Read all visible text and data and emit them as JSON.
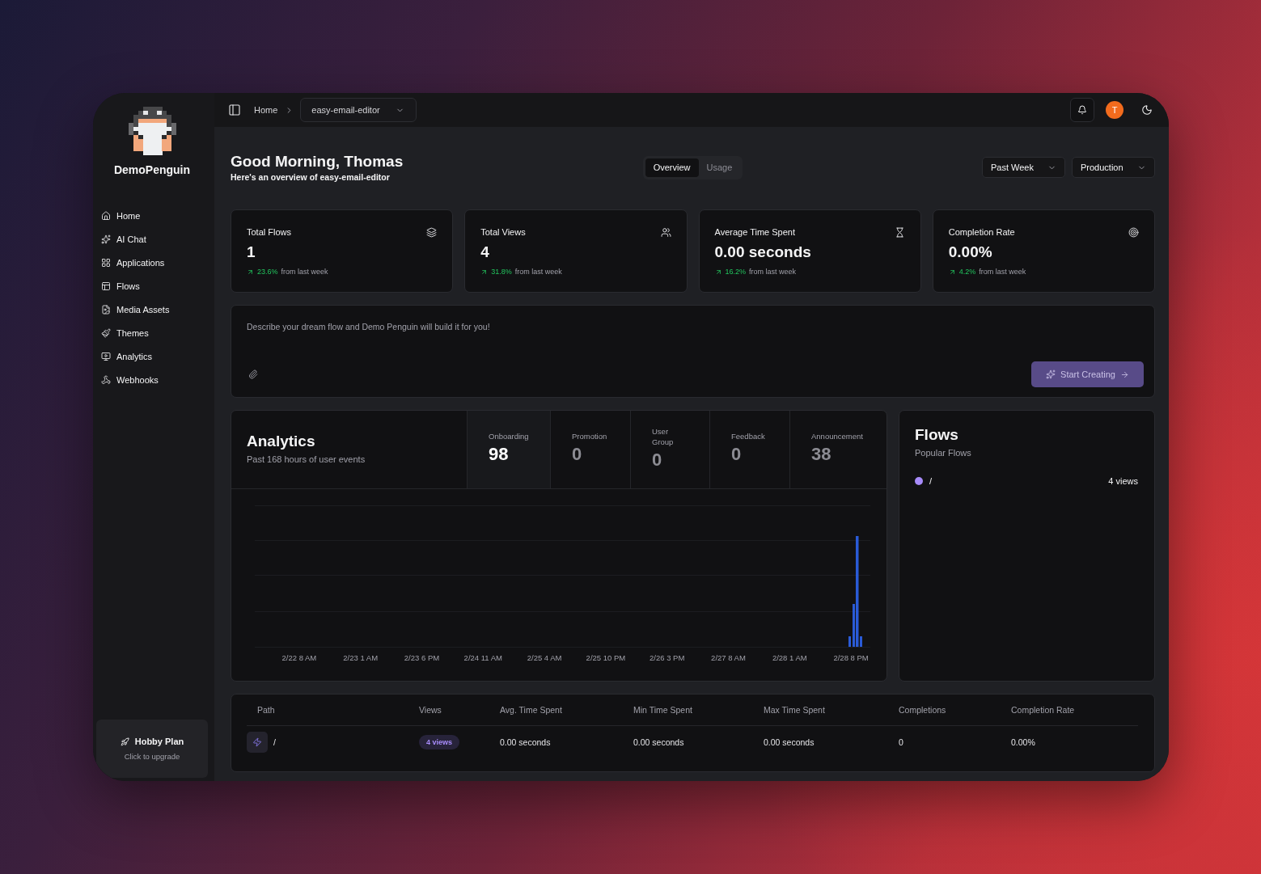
{
  "sidebar": {
    "brand": "DemoPenguin",
    "items": [
      {
        "label": "Home",
        "selected": false
      },
      {
        "label": "AI Chat",
        "selected": false
      },
      {
        "label": "Applications",
        "selected": false
      },
      {
        "label": "Flows",
        "selected": false
      },
      {
        "label": "Media Assets",
        "selected": false
      },
      {
        "label": "Themes",
        "selected": false
      },
      {
        "label": "Analytics",
        "selected": false
      },
      {
        "label": "Webhooks",
        "selected": false
      }
    ],
    "plan": {
      "name": "Hobby Plan",
      "hint": "Click to upgrade"
    }
  },
  "topbar": {
    "breadcrumb": "Home",
    "project": "easy-email-editor",
    "avatar": "T"
  },
  "header": {
    "title": "Good Morning, Thomas",
    "subtitle": "Here's an overview of easy-email-editor",
    "tabs": [
      {
        "label": "Overview",
        "selected": true
      },
      {
        "label": "Usage",
        "selected": false
      }
    ],
    "filters": [
      "Past Week",
      "Production"
    ]
  },
  "stats": [
    {
      "title": "Total Flows",
      "value": "1",
      "rising": true,
      "change": "23.6%",
      "note": "from last week"
    },
    {
      "title": "Total Views",
      "value": "4",
      "rising": true,
      "change": "31.8%",
      "note": "from last week"
    },
    {
      "title": "Average Time Spent",
      "value": "0.00 seconds",
      "rising": true,
      "change": "16.2%",
      "note": "from last week"
    },
    {
      "title": "Completion Rate",
      "value": "0.00%",
      "rising": true,
      "change": "4.2%",
      "note": "from last week"
    }
  ],
  "prompt": {
    "placeholder": "Describe your dream flow and Demo Penguin will build it for you!",
    "button": "Start Creating"
  },
  "analytics": {
    "title": "Analytics",
    "subtitle": "Past 168 hours of user events",
    "tabs": [
      {
        "label": "Onboarding",
        "value": "98",
        "selected": true
      },
      {
        "label": "Promotion",
        "value": "0",
        "selected": false
      },
      {
        "label": "User Group",
        "value": "0",
        "selected": false
      },
      {
        "label": "Feedback",
        "value": "0",
        "selected": false
      },
      {
        "label": "Announcement",
        "value": "38",
        "selected": false
      }
    ],
    "x_labels": [
      "2/22 8 AM",
      "2/23 1 AM",
      "2/23 6 PM",
      "2/24 11 AM",
      "2/25 4 AM",
      "2/25 10 PM",
      "2/26 3 PM",
      "2/27 8 AM",
      "2/28 1 AM",
      "2/28 8 PM"
    ]
  },
  "flows": {
    "title": "Flows",
    "subtitle": "Popular Flows",
    "items": [
      {
        "path": "/",
        "views": "4 views",
        "color": "#a78bfa"
      }
    ]
  },
  "table": {
    "columns": [
      "Path",
      "Views",
      "Avg. Time Spent",
      "Min Time Spent",
      "Max Time Spent",
      "Completions",
      "Completion Rate"
    ],
    "rows": [
      {
        "path": "/",
        "views": "4 views",
        "avg_time": "0.00 seconds",
        "min_time": "0.00 seconds",
        "max_time": "0.00 seconds",
        "completions": "0",
        "completion_rate": "0.00%"
      }
    ]
  }
}
